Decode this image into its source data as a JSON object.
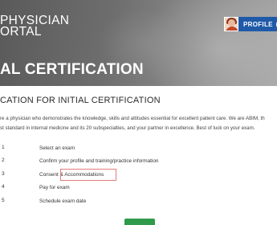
{
  "header": {
    "brand_line1": "PHYSICIAN",
    "brand_line2": "ORTAL",
    "profile_label": "PROFILE",
    "profile_icon": "chevron-down-icon",
    "hero_title": "AL CERTIFICATION"
  },
  "main": {
    "section_title": "CATION FOR INITIAL CERTIFICATION",
    "intro_line1": "re a physician who demonstrates the knowledge, skills and attitudes essential for excellent patient care. We are ABIM, th",
    "intro_line2": "st standard in internal medicine and its 20 subspecialties, and your partner in excellence. Best of luck on your exam.",
    "steps": [
      {
        "num": "1",
        "label": "Select an exam"
      },
      {
        "num": "2",
        "label": "Confirm your profile and training/practice information"
      },
      {
        "num": "3",
        "label": "Consent & Accommodations"
      },
      {
        "num": "4",
        "label": "Pay for exam"
      },
      {
        "num": "5",
        "label": "Schedule exam date"
      }
    ]
  },
  "colors": {
    "profile_button": "#1f5aa8",
    "highlight_border": "#e37d7d",
    "cta_button": "#2e9a4a"
  }
}
